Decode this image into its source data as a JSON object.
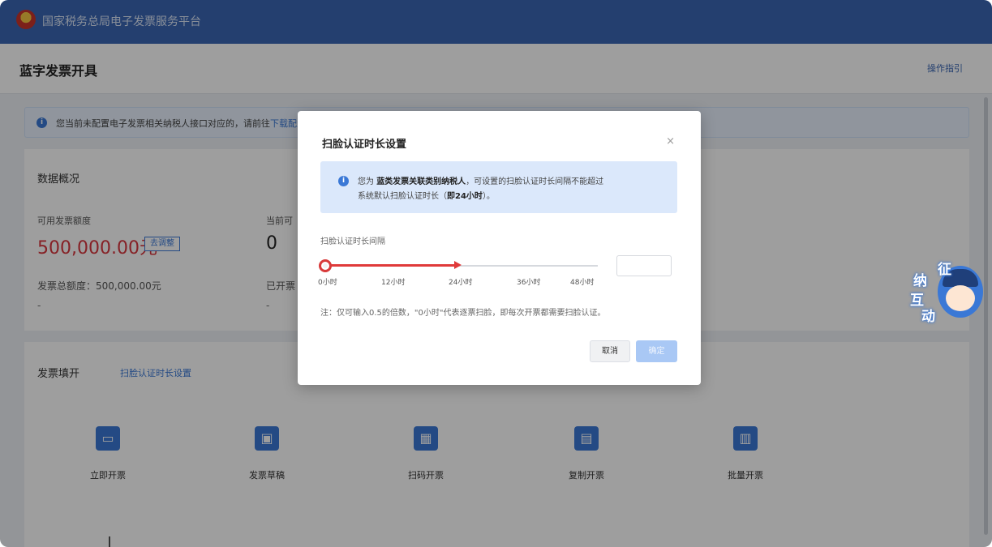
{
  "app": {
    "title": "国家税务总局电子发票服务平台",
    "page_title": "蓝字发票开具",
    "guide_link": "操作指引"
  },
  "notice": {
    "text": "您当前未配置电子发票相关纳税人接口对应的，请前往",
    "link": "下载配置"
  },
  "overview": {
    "title": "数据概况",
    "available_quota_label": "可用发票额度",
    "available_quota_value": "500,000.00元",
    "apply_button": "去调整",
    "current_label": "当前可",
    "current_value": "0",
    "total_quota_label": "发票总额度：",
    "total_quota_value": "500,000.00元",
    "issued_label": "已开票",
    "dash1": "-",
    "dash2": "-"
  },
  "issue": {
    "title": "发票填开",
    "scan_setting_link": "扫脸认证时长设置",
    "tiles": [
      {
        "label": "立即开票",
        "icon": "invoice-icon",
        "glyph": "▭"
      },
      {
        "label": "发票草稿",
        "icon": "draft-icon",
        "glyph": "▣"
      },
      {
        "label": "扫码开票",
        "icon": "qrcode-icon",
        "glyph": "▦"
      },
      {
        "label": "复制开票",
        "icon": "copy-icon",
        "glyph": "▤"
      },
      {
        "label": "批量开票",
        "icon": "batch-icon",
        "glyph": "▥"
      }
    ]
  },
  "modal": {
    "title": "扫脸认证时长设置",
    "close": "×",
    "info_prefix": "您为 ",
    "info_strong": "蓝类发票关联类别纳税人",
    "info_suffix": "，可设置的扫脸认证时长间隔不能超过",
    "info_line2_prefix": "系统默认扫脸认证时长（",
    "info_line2_strong": "即24小时",
    "info_line2_suffix": "）。",
    "slider_label": "扫脸认证时长间隔",
    "ticks": [
      "0小时",
      "12小时",
      "24小时",
      "36小时",
      "48小时"
    ],
    "slider_value_hours": 0,
    "slider_max_hours": 48,
    "input_value": "",
    "note": "注：仅可输入0.5的倍数，\"0小时\"代表逐票扫脸，即每次开票都需要扫脸认证。",
    "cancel": "取消",
    "confirm": "确定"
  },
  "mascot": {
    "chars": [
      "征",
      "纳",
      "互",
      "动"
    ]
  },
  "colors": {
    "brand": "#3a67b4",
    "accent": "#3a78d6",
    "danger": "#d9363e"
  }
}
